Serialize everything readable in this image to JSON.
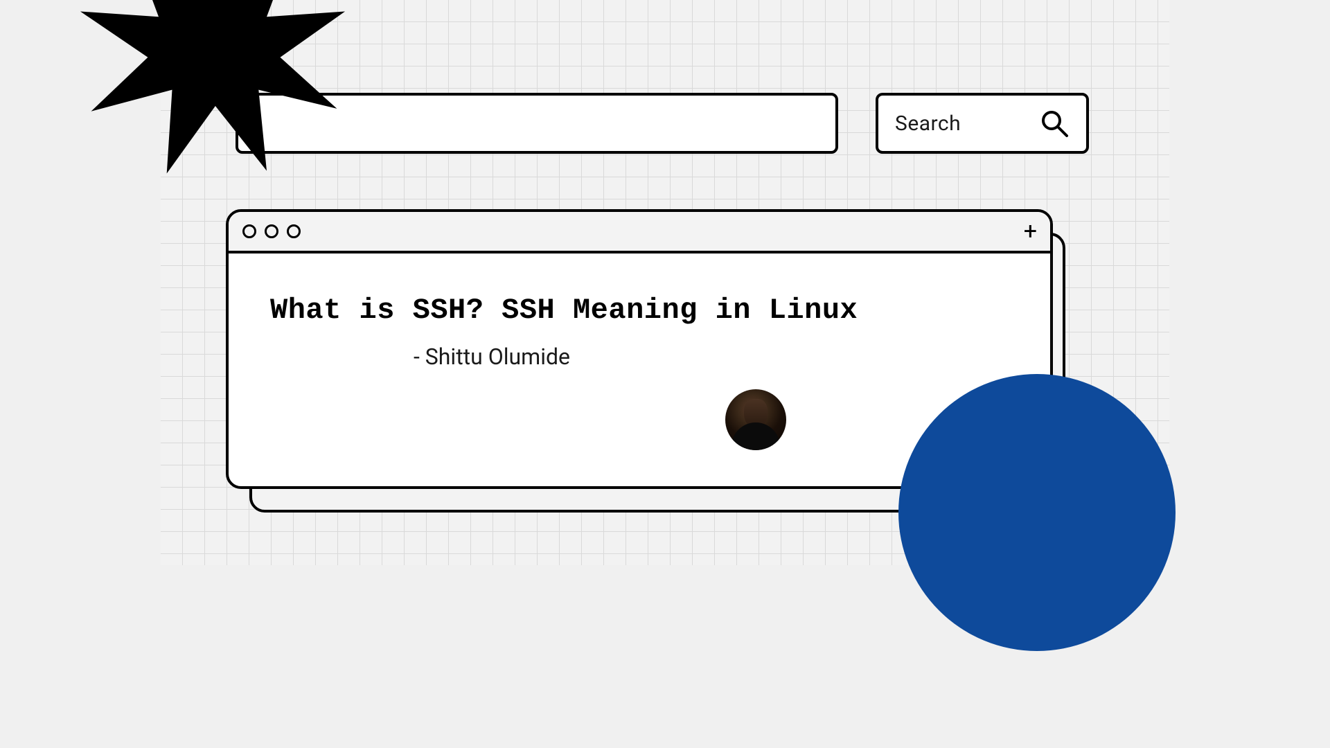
{
  "search": {
    "label": "Search"
  },
  "window": {
    "plus": "+",
    "title": "What is SSH? SSH Meaning in Linux",
    "byline": "- Shittu Olumide"
  },
  "colors": {
    "accent_circle": "#0e4a9b"
  }
}
